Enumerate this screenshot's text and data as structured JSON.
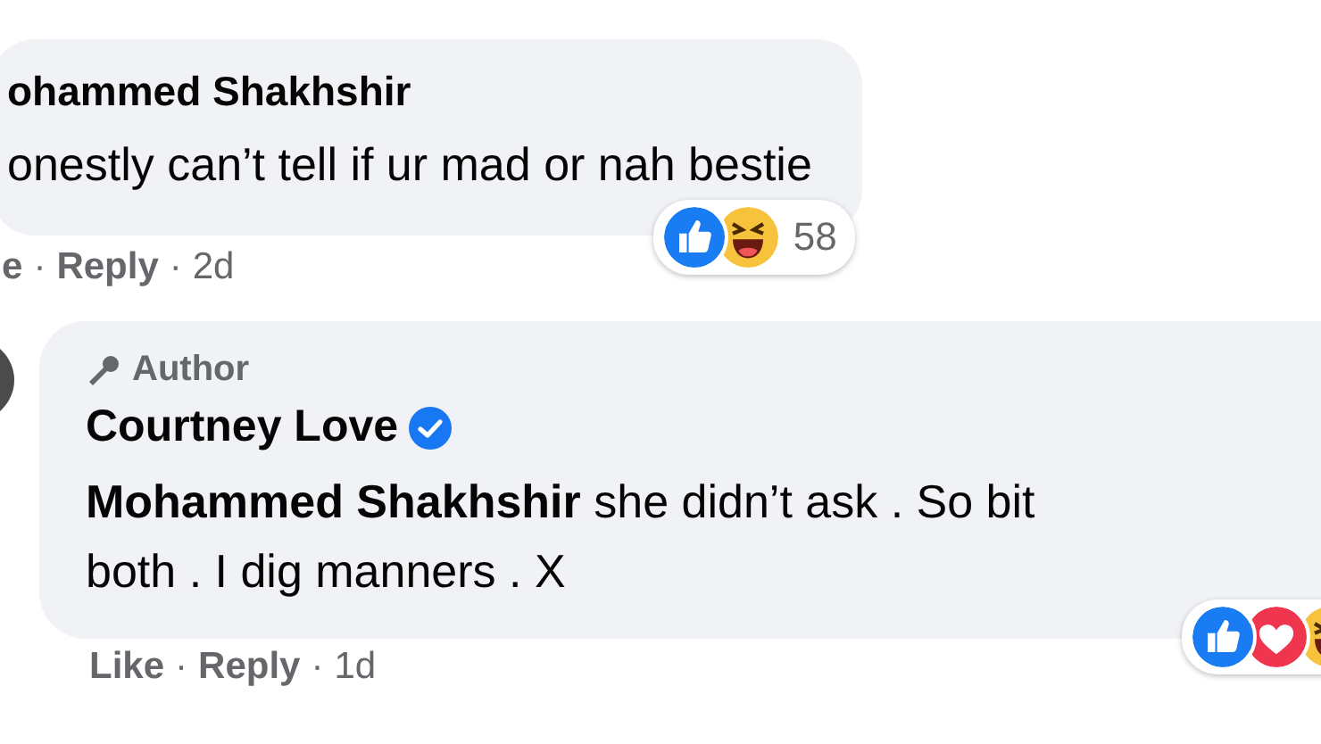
{
  "comments": [
    {
      "author": "ohammed Shakhshir",
      "text_lines": [
        "onestly can’t tell if ur mad or nah bestie"
      ],
      "reactions": [
        {
          "kind": "like"
        },
        {
          "kind": "haha"
        }
      ],
      "reaction_count": "58",
      "actions": [
        "e",
        "Reply",
        "2d"
      ],
      "separator": "·"
    },
    {
      "author": "Courtney Love",
      "author_badge": "Author",
      "verified": true,
      "text_lines": [
        "**Mohammed Shakhshir** she didn’t ask . So bit",
        "both . I dig manners . X"
      ],
      "reactions": [
        {
          "kind": "like"
        },
        {
          "kind": "love"
        },
        {
          "kind": "haha"
        }
      ],
      "actions": [
        "Like",
        "Reply",
        "1d"
      ],
      "separator": "·"
    }
  ]
}
